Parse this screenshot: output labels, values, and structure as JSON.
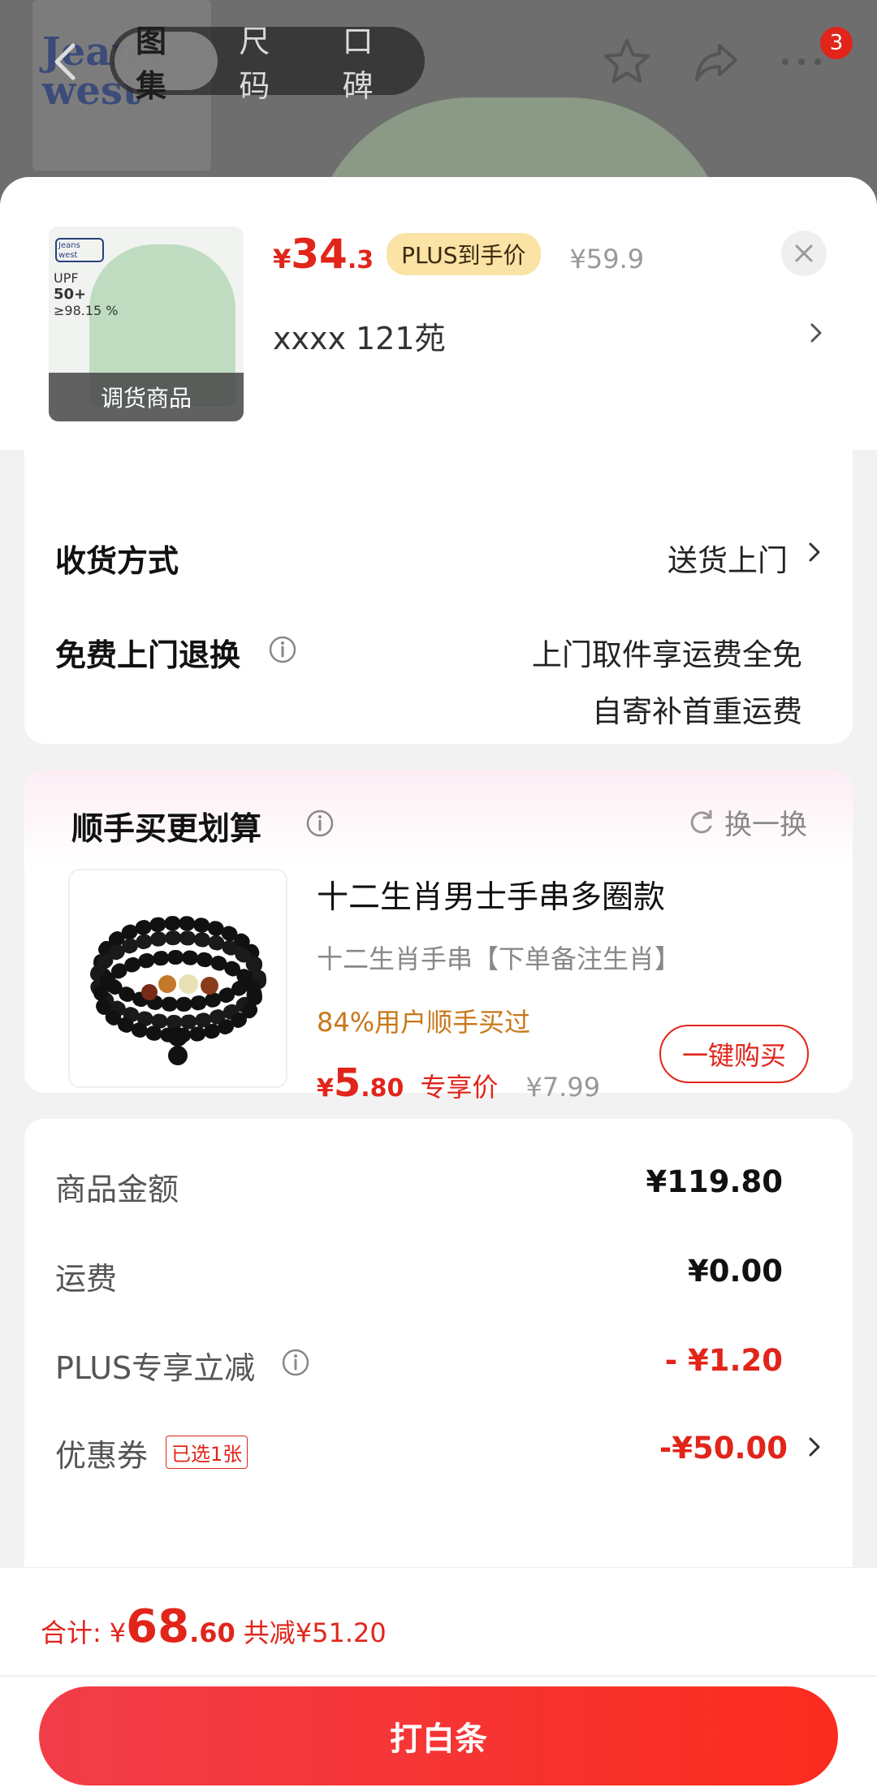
{
  "header": {
    "tabs": [
      {
        "label": "图集",
        "active": true
      },
      {
        "label": "尺码",
        "active": false
      },
      {
        "label": "口碑",
        "active": false
      }
    ],
    "cart_badge": "3",
    "icons": [
      "back-icon",
      "star-icon",
      "share-icon",
      "more-icon"
    ]
  },
  "product": {
    "thumb_overlay": "调货商品",
    "thumb_spec": [
      "UPF",
      "50+",
      "≥98.15 %"
    ],
    "thumb_logo": "Jeans west",
    "price_symbol": "¥",
    "price_int": "34",
    "price_dec": ".3",
    "plus_tag": "PLUS到手价",
    "original_price": "¥59.9",
    "address": "xxxx  121苑"
  },
  "delivery": {
    "method_label": "收货方式",
    "method_value": "送货上门",
    "return_label": "免费上门退换",
    "return_value_1": "上门取件享运费全免",
    "return_value_2": "自寄补首重运费"
  },
  "addon": {
    "title": "顺手买更划算",
    "swap_label": "换一换",
    "name": "十二生肖男士手串多圈款",
    "subtitle": "十二生肖手串【下单备注生肖】",
    "bought": "84%用户顺手买过",
    "price_symbol": "¥",
    "price_int": "5",
    "price_dec": ".80",
    "price_tag": "专享价",
    "original_price": "¥7.99",
    "buy_label": "一键购买"
  },
  "fees": {
    "goods_label": "商品金额",
    "goods_value": "¥119.80",
    "shipping_label": "运费",
    "shipping_value": "¥0.00",
    "plus_label": "PLUS专享立减",
    "plus_value": "- ¥1.20",
    "coupon_label": "优惠券",
    "coupon_tag": "已选1张",
    "coupon_value": "-¥50.00"
  },
  "footer": {
    "total_label": "合计:",
    "total_symbol": "¥",
    "total_int": "68",
    "total_dec": ".60",
    "saved": "共减¥51.20",
    "pay_label": "打白条"
  },
  "colors": {
    "accent": "#e1251b",
    "plus_tag_bg": "#fbe2a5",
    "bought_text": "#c9771a"
  }
}
